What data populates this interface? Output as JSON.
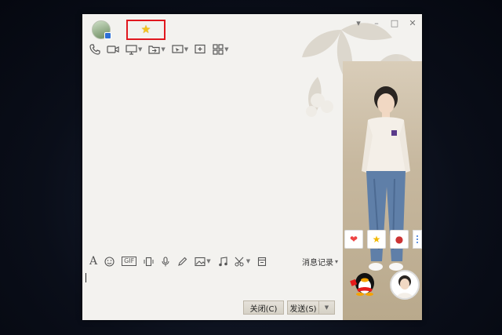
{
  "window": {
    "star_glyph": "★",
    "controls": {
      "menu": "▾",
      "minimize": "–",
      "maximize": "□",
      "close": "✕"
    }
  },
  "toolbar": {
    "icons": [
      "phone-icon",
      "video-icon",
      "screen-share-icon",
      "file-transfer-icon",
      "remote-desktop-icon",
      "add-member-icon",
      "apps-icon"
    ]
  },
  "input_toolbar": {
    "icons": [
      "font-icon",
      "emoji-icon",
      "gif-icon",
      "shake-icon",
      "voice-icon",
      "handwrite-icon",
      "image-icon",
      "music-icon",
      "screenshot-icon",
      "history-icon"
    ],
    "gif_label": "GIF",
    "history_label": "消息记录",
    "history_caret": "▾"
  },
  "buttons": {
    "close_label": "关闭(C)",
    "send_label": "发送(S)",
    "send_dropdown": "▼"
  },
  "colors": {
    "highlight": "#e1181f",
    "star": "#f5c21b",
    "accent": "#2d6fd6"
  }
}
